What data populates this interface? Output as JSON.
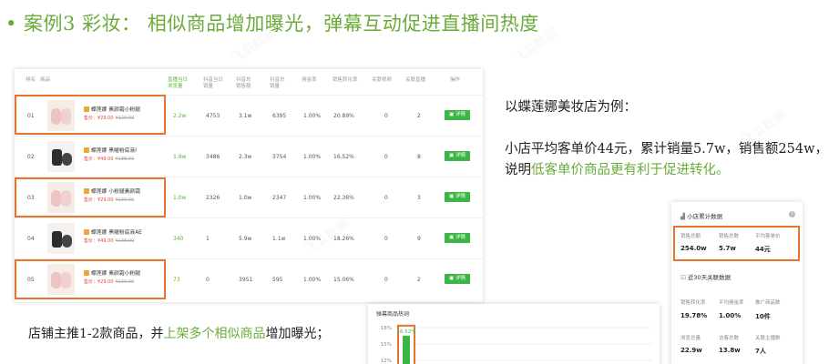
{
  "heading": {
    "bullet": "•",
    "text": "案例3 彩妆：  相似商品增加曝光，弹幕互动促进直播间热度"
  },
  "table": {
    "headers": [
      "排名",
      "商品",
      "直播当日\n浏览量",
      "抖音当日\n销量",
      "抖音总\n销售额",
      "抖音总\n销量",
      "佣金率",
      "销售转化率",
      "关联视频",
      "关联直播",
      "操作"
    ],
    "rows": [
      {
        "rank": "01",
        "name": "蝶莲娜 素颜霜小粉腿",
        "price": "售价：¥29.00",
        "old": "¥129.00",
        "views": "2.2w",
        "daily": "4753",
        "gmv": "3.1w",
        "sales": "6395",
        "commission": "1.00%",
        "conversion": "20.89%",
        "videos": "0",
        "lives": "2",
        "action": "详情"
      },
      {
        "rank": "02",
        "name": "蝶莲娜 黑曜粉底液Ⅰ",
        "price": "售价：¥49.00",
        "old": "¥138.00",
        "views": "1.9w",
        "daily": "3486",
        "gmv": "2.3w",
        "sales": "3754",
        "commission": "1.00%",
        "conversion": "16.52%",
        "videos": "0",
        "lives": "8",
        "action": "详情"
      },
      {
        "rank": "03",
        "name": "蝶莲娜 小粉腿素颜霜",
        "price": "售价：¥29.00",
        "old": "¥129.00",
        "views": "1.0w",
        "daily": "2326",
        "gmv": "1.0w",
        "sales": "2347",
        "commission": "1.00%",
        "conversion": "22.36%",
        "videos": "0",
        "lives": "3",
        "action": "详情"
      },
      {
        "rank": "04",
        "name": "蝶莲娜 黑曜粉底液AE",
        "price": "售价：¥49.00",
        "old": "¥138.00",
        "views": "340",
        "daily": "1",
        "gmv": "5.9w",
        "sales": "1.1w",
        "commission": "1.00%",
        "conversion": "18.26%",
        "videos": "0",
        "lives": "9",
        "action": "详情"
      },
      {
        "rank": "05",
        "name": "蝶莲娜 素颜霜小粉腿",
        "price": "售价：¥29.00",
        "old": "¥129.00",
        "views": "73",
        "daily": "0",
        "gmv": "3951",
        "sales": "595",
        "commission": "1.00%",
        "conversion": "15.06%",
        "videos": "0",
        "lives": "2",
        "action": "详情"
      }
    ]
  },
  "right_text": {
    "line1": "以蝶莲娜美妆店为例：",
    "line2": "小店平均客单价44元，累计销量5.7w，销售额254w，",
    "line3_prefix": "说明",
    "line3_highlight": "低客单价商品更有利于促进转化。"
  },
  "stats_card": {
    "title": "小店累计数据",
    "info_icon": "i",
    "top": [
      {
        "label": "销售总额",
        "value": "254.0w"
      },
      {
        "label": "销售总数",
        "value": "5.7w"
      },
      {
        "label": "平均客单价",
        "value": "44元"
      }
    ],
    "subtitle": "近30天关联数据",
    "grid": [
      {
        "label": "销售转化率",
        "value": "19.78%"
      },
      {
        "label": "平均佣金率",
        "value": "1.00%"
      },
      {
        "label": "推广商品数",
        "value": "10件"
      },
      {
        "label": "浏览总量",
        "value": "22.9w"
      },
      {
        "label": "访客总数",
        "value": "13.8w"
      },
      {
        "label": "关联主播数",
        "value": "7人"
      }
    ]
  },
  "bottom_text": {
    "prefix": "店铺主推1-2款商品，并",
    "highlight": "上架多个相似商品",
    "suffix": "增加曝光；"
  },
  "danmu_card": {
    "title": "弹幕商品热词"
  },
  "chart_data": {
    "type": "bar",
    "title": "弹幕商品热词",
    "categories": [
      ""
    ],
    "values": [
      16.52
    ],
    "value_labels": [
      "16.52%"
    ],
    "ytick_labels": [
      "18%",
      "15%",
      "12%"
    ],
    "ylim": [
      12,
      18
    ],
    "colors": {
      "bar": "#3bb545",
      "highlight": "#e8752e"
    }
  },
  "watermark": "飞瓜数据",
  "colors": {
    "accent": "#6aab3a",
    "highlight_box": "#e8752e",
    "button": "#3bb545",
    "price": "#e2463a"
  }
}
